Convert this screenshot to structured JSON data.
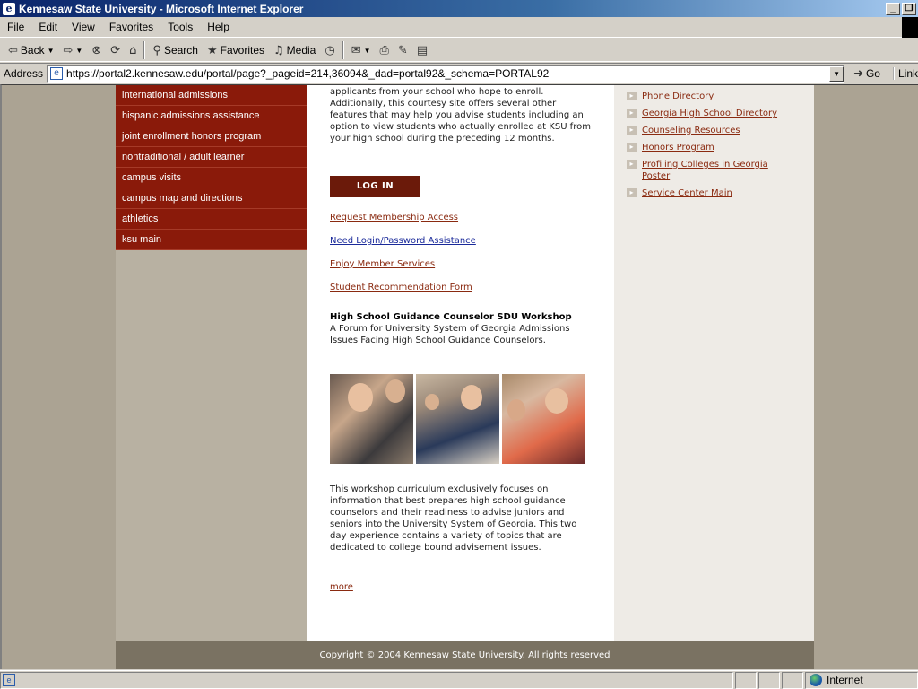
{
  "window": {
    "title": "Kennesaw State University - Microsoft Internet Explorer"
  },
  "menu": [
    "File",
    "Edit",
    "View",
    "Favorites",
    "Tools",
    "Help"
  ],
  "toolbar": {
    "back": "Back",
    "search": "Search",
    "favorites": "Favorites",
    "media": "Media"
  },
  "address": {
    "label": "Address",
    "url": "https://portal2.kennesaw.edu/portal/page?_pageid=214,36094&_dad=portal92&_schema=PORTAL92",
    "go": "Go",
    "links": "Link"
  },
  "left_nav": [
    "international admissions",
    "hispanic admissions assistance",
    "joint enrollment honors program",
    "nontraditional / adult learner",
    "campus visits",
    "campus map and directions",
    "athletics",
    "ksu main"
  ],
  "main": {
    "intro_partial": "Admissions collaborative so you may monitor all applicants from your school who hope to enroll. Additionally, this courtesy site offers several other features that may help you advise students including an option to view students who actually enrolled at KSU from your high school during the preceding 12 months.",
    "login_label": "LOG IN",
    "links": {
      "request": "Request Membership Access",
      "login_help": "Need Login/Password Assistance",
      "member_services": "Enjoy Member Services",
      "recommendation": "Student Recommendation Form"
    },
    "workshop_title": "High School Guidance Counselor SDU Workshop",
    "workshop_desc": "A Forum for University System of Georgia Admissions Issues Facing High School Guidance Counselors.",
    "workshop_body": "This workshop curriculum exclusively focuses on information that best prepares high school guidance counselors and their readiness to advise juniors and seniors into the University System of Georgia. This two day experience contains a variety of topics that are dedicated to college bound advisement issues.",
    "more": "more"
  },
  "right_links": [
    "Phone Directory",
    "Georgia High School Directory",
    "Counseling Resources",
    "Honors Program",
    "Profiling Colleges in Georgia Poster",
    "Service Center Main"
  ],
  "footer": "Copyright © 2004 Kennesaw State University. All rights reserved",
  "status": {
    "zone": "Internet"
  }
}
